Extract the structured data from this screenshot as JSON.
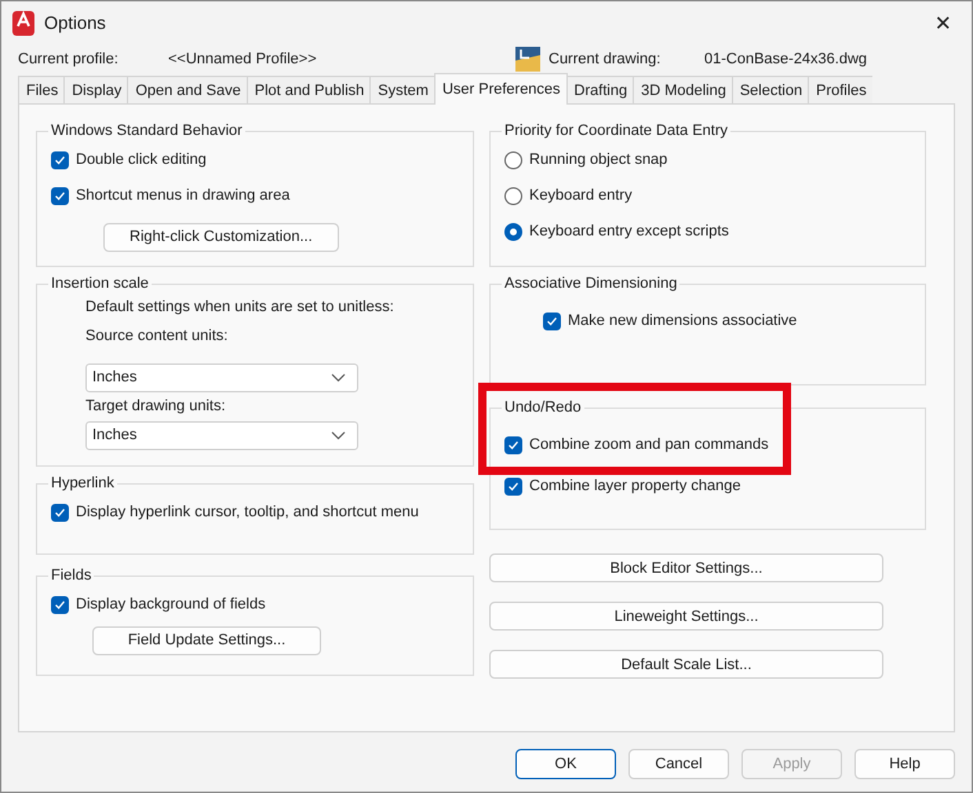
{
  "window": {
    "title": "Options",
    "close": "✕"
  },
  "profile": {
    "label": "Current profile:",
    "value": "<<Unnamed Profile>>"
  },
  "drawing": {
    "label": "Current drawing:",
    "value": "01-ConBase-24x36.dwg"
  },
  "tabs": [
    {
      "label": "Files",
      "selected": false
    },
    {
      "label": "Display",
      "selected": false
    },
    {
      "label": "Open and Save",
      "selected": false
    },
    {
      "label": "Plot and Publish",
      "selected": false
    },
    {
      "label": "System",
      "selected": false
    },
    {
      "label": "User Preferences",
      "selected": true
    },
    {
      "label": "Drafting",
      "selected": false
    },
    {
      "label": "3D Modeling",
      "selected": false
    },
    {
      "label": "Selection",
      "selected": false
    },
    {
      "label": "Profiles",
      "selected": false
    }
  ],
  "left_groups": [
    {
      "title": "Windows Standard Behavior",
      "items": [
        {
          "kind": "checkbox",
          "label": "Double click editing",
          "checked": true
        },
        {
          "kind": "checkbox",
          "label": "Shortcut menus in drawing area",
          "checked": true
        },
        {
          "kind": "button",
          "label": "Right-click Customization..."
        }
      ]
    },
    {
      "title": "Insertion scale",
      "items": [
        {
          "kind": "text",
          "label": "Default settings when units are set to unitless:"
        },
        {
          "kind": "text",
          "label": "Source content units:"
        },
        {
          "kind": "select",
          "value": "Inches"
        },
        {
          "kind": "text",
          "label": "Target drawing units:"
        },
        {
          "kind": "select",
          "value": "Inches"
        }
      ]
    },
    {
      "title": "Hyperlink",
      "items": [
        {
          "kind": "checkbox",
          "label": "Display hyperlink cursor, tooltip, and shortcut menu",
          "checked": true
        }
      ]
    },
    {
      "title": "Fields",
      "items": [
        {
          "kind": "checkbox",
          "label": "Display background of fields",
          "checked": true
        },
        {
          "kind": "button",
          "label": "Field Update Settings..."
        }
      ]
    }
  ],
  "right_groups": [
    {
      "title": "Priority for Coordinate Data Entry",
      "items": [
        {
          "kind": "radio",
          "label": "Running object snap",
          "selected": false
        },
        {
          "kind": "radio",
          "label": "Keyboard entry",
          "selected": false
        },
        {
          "kind": "radio",
          "label": "Keyboard entry except scripts",
          "selected": true
        }
      ]
    },
    {
      "title": "Associative Dimensioning",
      "items": [
        {
          "kind": "checkbox",
          "label": "Make new dimensions associative",
          "checked": true
        }
      ]
    },
    {
      "title": "Undo/Redo",
      "items": [
        {
          "kind": "checkbox",
          "label": "Combine zoom and pan commands",
          "checked": true
        },
        {
          "kind": "checkbox",
          "label": "Combine layer property change",
          "checked": true
        }
      ]
    }
  ],
  "right_buttons": [
    "Block Editor Settings...",
    "Lineweight Settings...",
    "Default Scale List..."
  ],
  "footer_buttons": [
    {
      "label": "OK",
      "disabled": false,
      "default": true
    },
    {
      "label": "Cancel",
      "disabled": false,
      "default": false
    },
    {
      "label": "Apply",
      "disabled": true,
      "default": false
    },
    {
      "label": "Help",
      "disabled": false,
      "default": false
    }
  ]
}
